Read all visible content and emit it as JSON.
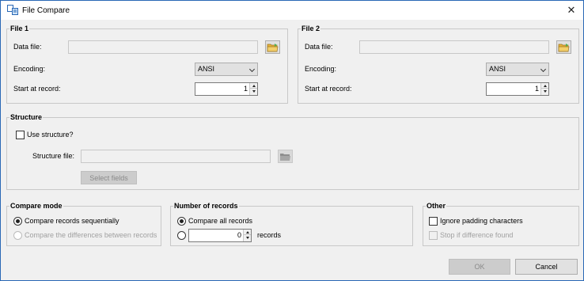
{
  "window": {
    "title": "File Compare",
    "close_glyph": "✕",
    "icon": "file-compare-icon"
  },
  "file1": {
    "legend": "File 1",
    "data_file_label": "Data file:",
    "data_file_value": "",
    "encoding_label": "Encoding:",
    "encoding_value": "ANSI",
    "start_label": "Start at record:",
    "start_value": "1"
  },
  "file2": {
    "legend": "File 2",
    "data_file_label": "Data file:",
    "data_file_value": "",
    "encoding_label": "Encoding:",
    "encoding_value": "ANSI",
    "start_label": "Start at record:",
    "start_value": "1"
  },
  "structure": {
    "legend": "Structure",
    "use_structure_label": "Use structure?",
    "use_structure_checked": false,
    "structure_file_label": "Structure file:",
    "structure_file_value": "",
    "select_fields_label": "Select fields"
  },
  "compare_mode": {
    "legend": "Compare mode",
    "sequential_label": "Compare records sequentially",
    "differences_label": "Compare the differences between records",
    "selected": "sequential"
  },
  "number_of_records": {
    "legend": "Number of records",
    "all_label": "Compare all records",
    "count_value": "0",
    "records_label": "records",
    "selected": "all"
  },
  "other": {
    "legend": "Other",
    "ignore_padding_label": "Ignore padding characters",
    "stop_if_diff_label": "Stop if difference found"
  },
  "footer": {
    "ok_label": "OK",
    "cancel_label": "Cancel"
  },
  "colors": {
    "window_border": "#2a68b5",
    "folder_icon": "#e8b339",
    "folder_arrow": "#4caf50"
  }
}
